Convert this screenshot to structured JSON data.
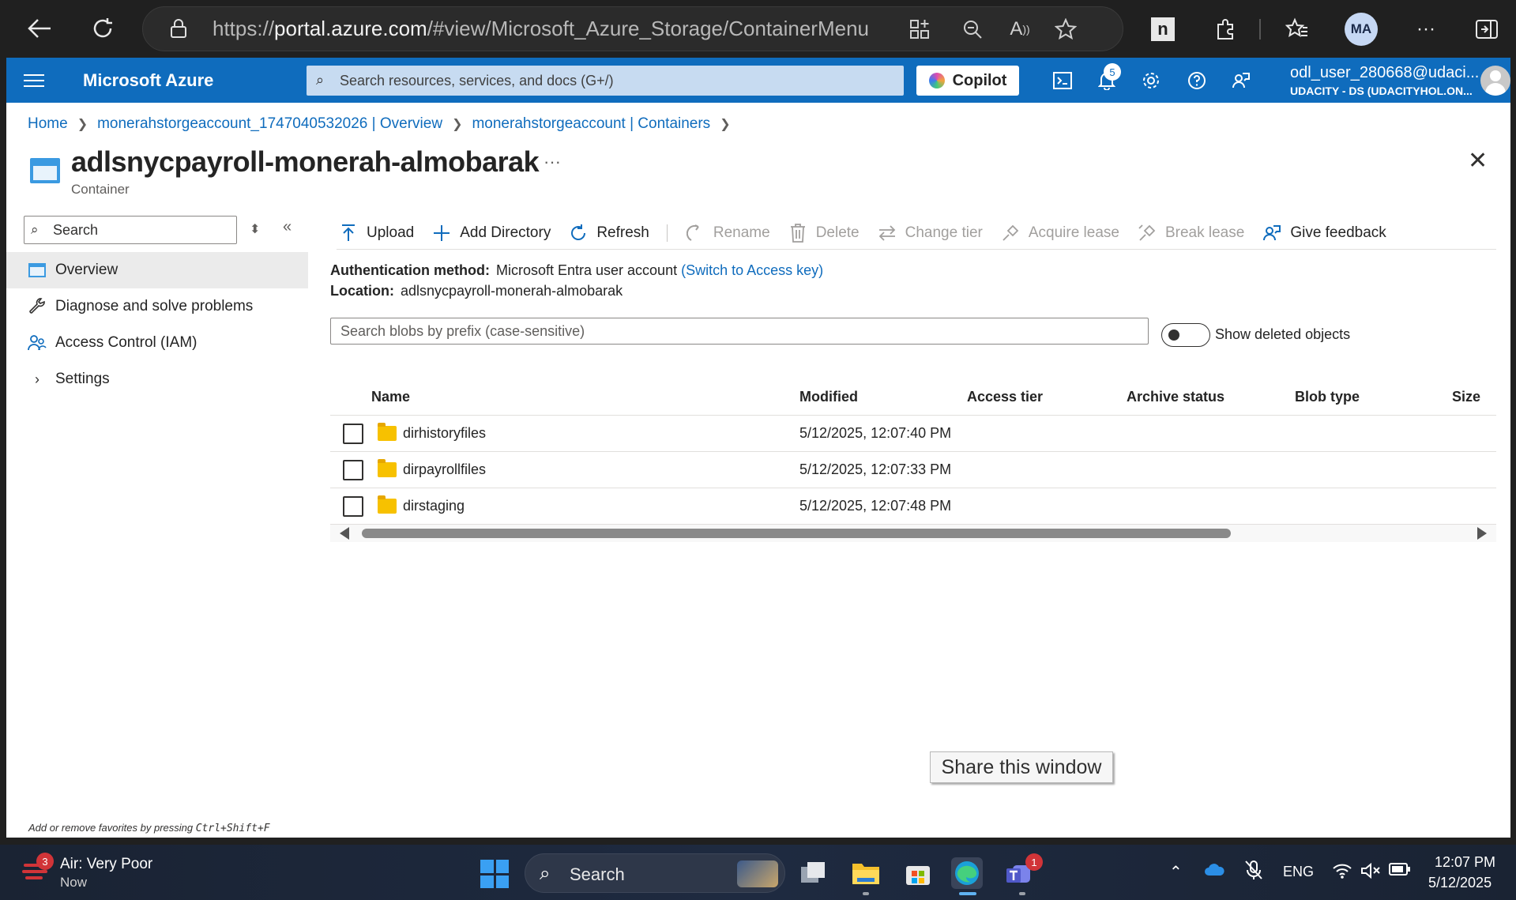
{
  "browser": {
    "url_prefix": "https://",
    "url_host": "portal.azure.com",
    "url_rest": "/#view/Microsoft_Azure_Storage/ContainerMenuB...",
    "profile_initials": "MA"
  },
  "header": {
    "brand": "Microsoft Azure",
    "search_placeholder": "Search resources, services, and docs (G+/)",
    "copilot_label": "Copilot",
    "notification_count": "5",
    "user_name": "odl_user_280668@udaci...",
    "user_org": "UDACITY - DS (UDACITYHOL.ON..."
  },
  "breadcrumb": [
    "Home",
    "monerahstorgeaccount_1747040532026 | Overview",
    "monerahstorgeaccount | Containers"
  ],
  "page": {
    "title": "adlsnycpayroll-monerah-almobarak",
    "subtitle": "Container",
    "more": "···",
    "close": "✕"
  },
  "nav": {
    "search_placeholder": "Search",
    "items": [
      {
        "label": "Overview",
        "icon": "container-icon",
        "active": true
      },
      {
        "label": "Diagnose and solve problems",
        "icon": "wrench-icon"
      },
      {
        "label": "Access Control (IAM)",
        "icon": "people-icon"
      },
      {
        "label": "Settings",
        "icon": "chevron-right-icon"
      }
    ],
    "footer_prefix": "Add or remove favorites by pressing ",
    "footer_shortcut": "Ctrl+Shift+F"
  },
  "toolbar": {
    "upload": "Upload",
    "add_directory": "Add Directory",
    "refresh": "Refresh",
    "rename": "Rename",
    "delete": "Delete",
    "change_tier": "Change tier",
    "acquire_lease": "Acquire lease",
    "break_lease": "Break lease",
    "give_feedback": "Give feedback"
  },
  "info": {
    "auth_label": "Authentication method:",
    "auth_value": "Microsoft Entra user account",
    "auth_link": "(Switch to Access key)",
    "location_label": "Location:",
    "location_value": "adlsnycpayroll-monerah-almobarak"
  },
  "blob_search": {
    "placeholder": "Search blobs by prefix (case-sensitive)",
    "toggle_label": "Show deleted objects"
  },
  "table": {
    "columns": [
      "Name",
      "Modified",
      "Access tier",
      "Archive status",
      "Blob type",
      "Size"
    ],
    "rows": [
      {
        "name": "dirhistoryfiles",
        "modified": "5/12/2025, 12:07:40 PM"
      },
      {
        "name": "dirpayrollfiles",
        "modified": "5/12/2025, 12:07:33 PM"
      },
      {
        "name": "dirstaging",
        "modified": "5/12/2025, 12:07:48 PM"
      }
    ]
  },
  "share_window": "Share this window",
  "taskbar": {
    "weather_badge": "3",
    "weather_title": "Air: Very Poor",
    "weather_sub": "Now",
    "search_label": "Search",
    "teams_badge": "1",
    "language": "ENG",
    "time": "12:07 PM",
    "date": "5/12/2025"
  },
  "colors": {
    "azure_blue": "#0f6cbd",
    "folder_yellow": "#f7c100",
    "taskbar": "#1e2a40"
  }
}
